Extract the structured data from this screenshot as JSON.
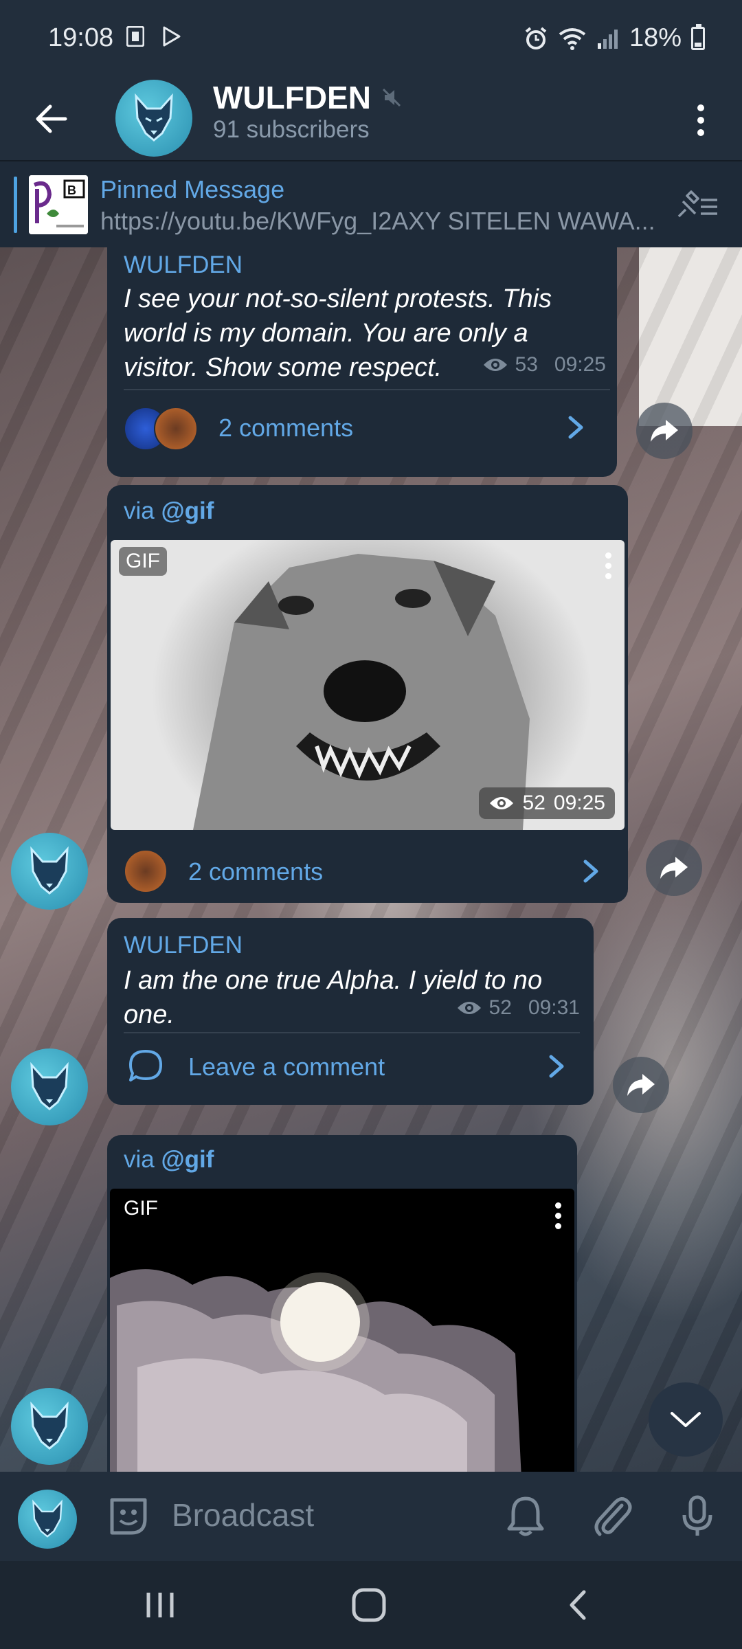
{
  "status_bar": {
    "time": "19:08",
    "battery": "18%"
  },
  "header": {
    "title": "WULFDEN",
    "subtitle": "91 subscribers"
  },
  "pinned": {
    "title": "Pinned Message",
    "text": "https://youtu.be/KWFyg_I2AXY SITELEN WAWA..."
  },
  "messages": [
    {
      "author": "WULFDEN",
      "text": "I see your not-so-silent protests. This world is my domain. You are only a visitor. Show some respect.",
      "views": "53",
      "time": "09:25",
      "comments": "2 comments"
    },
    {
      "via_prefix": "via",
      "via_bot": "@gif",
      "gif_label": "GIF",
      "views": "52",
      "time": "09:25",
      "comments": "2 comments"
    },
    {
      "author": "WULFDEN",
      "text": "I am the one true Alpha. I yield to no one.",
      "views": "52",
      "time": "09:31",
      "comments": "Leave a comment"
    },
    {
      "via_prefix": "via",
      "via_bot": "@gif",
      "gif_label": "GIF"
    }
  ],
  "composer": {
    "placeholder": "Broadcast"
  },
  "colors": {
    "accent": "#62a8e6",
    "bubble": "#1e2a38",
    "header": "#222e3c"
  }
}
